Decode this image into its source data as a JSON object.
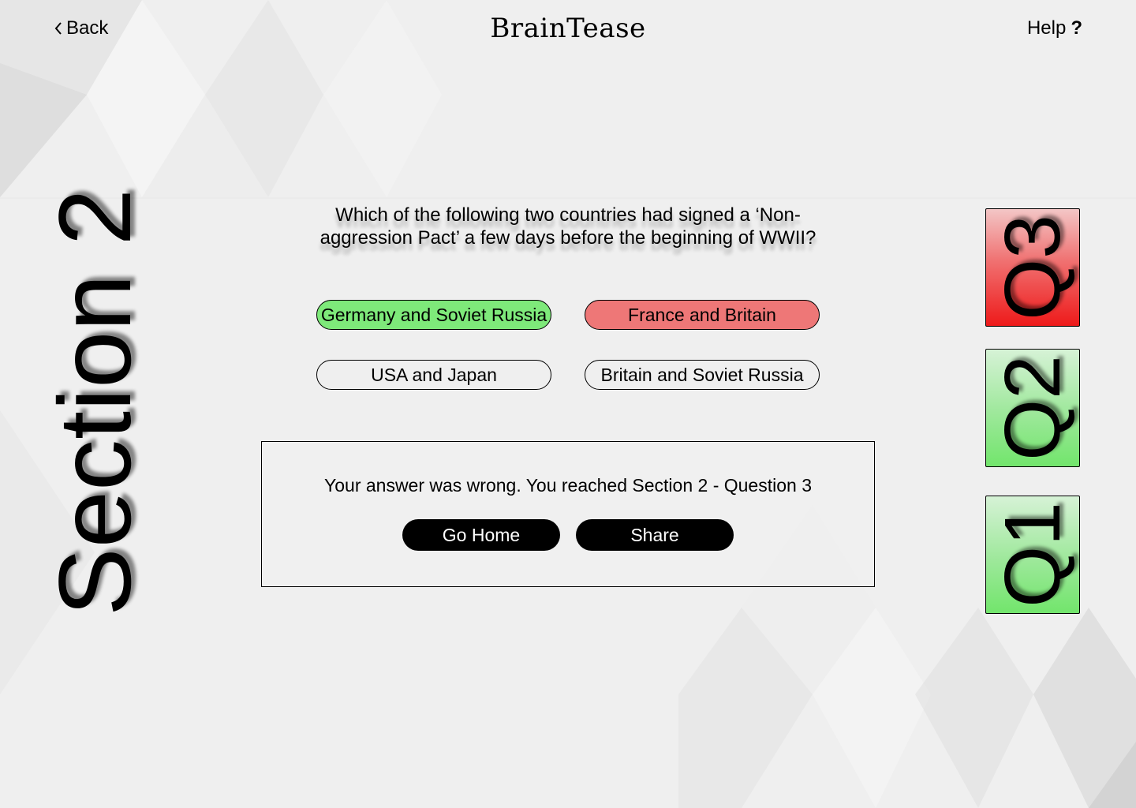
{
  "header": {
    "back_label": "Back",
    "brand": "BrainTease",
    "help_label": "Help",
    "help_mark": "?"
  },
  "section": {
    "label": "Section 2"
  },
  "question": {
    "text": "Which of the following two countries had signed a ‘Non-aggression Pact’ a few days before the beginning of WWII?",
    "answers": [
      {
        "label": "Germany and Soviet Russia",
        "state": "correct"
      },
      {
        "label": "France and Britain",
        "state": "wrong"
      },
      {
        "label": "USA and Japan",
        "state": "neutral"
      },
      {
        "label": "Britain and Soviet Russia",
        "state": "neutral"
      }
    ]
  },
  "result": {
    "message": "Your answer was wrong. You reached Section 2 - Question 3",
    "go_home_label": "Go Home",
    "share_label": "Share"
  },
  "progress": {
    "cards": [
      {
        "label": "Q3",
        "status": "wrong"
      },
      {
        "label": "Q2",
        "status": "correct"
      },
      {
        "label": "Q1",
        "status": "correct"
      }
    ]
  },
  "colors": {
    "correct": "#7ee97a",
    "wrong": "#ee7777",
    "card_wrong": "#ee1a1a",
    "card_correct": "#72e56c",
    "background": "#efefef"
  }
}
